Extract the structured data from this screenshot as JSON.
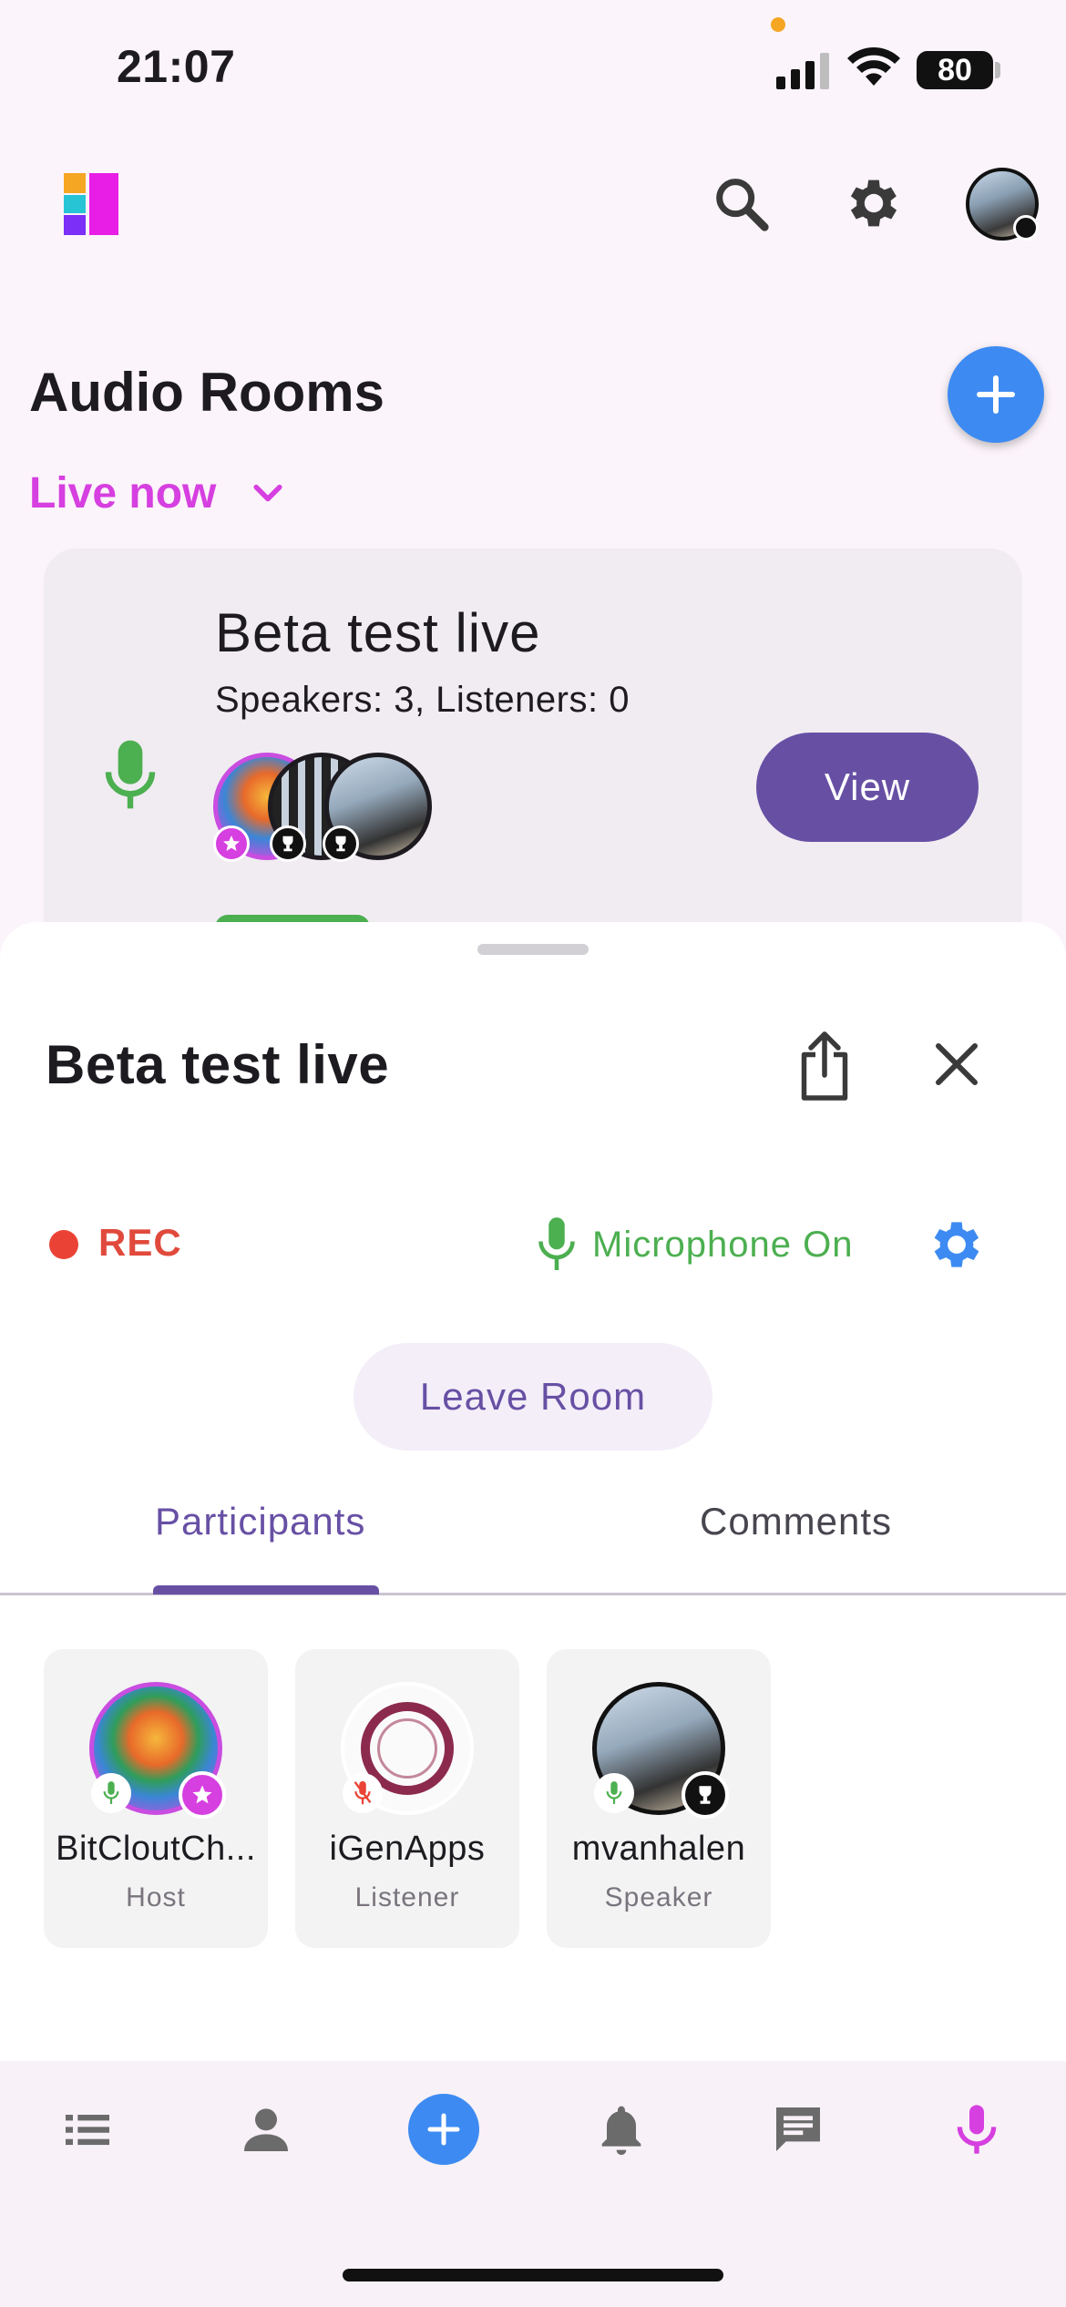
{
  "status_bar": {
    "time": "21:07",
    "battery": "80"
  },
  "header": {
    "title": "Audio Rooms",
    "filter_label": "Live now"
  },
  "room_card": {
    "title": "Beta test live",
    "subtitle": "Speakers: 3, Listeners: 0",
    "view_label": "View"
  },
  "sheet": {
    "title": "Beta test live",
    "rec_label": "REC",
    "mic_label": "Microphone On",
    "leave_label": "Leave Room",
    "tabs": [
      {
        "label": "Participants",
        "selected": true
      },
      {
        "label": "Comments",
        "selected": false
      }
    ],
    "participants": [
      {
        "name": "BitCloutCh...",
        "role": "Host",
        "mic": "on"
      },
      {
        "name": "iGenApps",
        "role": "Listener",
        "mic": "muted"
      },
      {
        "name": "mvanhalen",
        "role": "Speaker",
        "mic": "on"
      }
    ]
  },
  "colors": {
    "accent_magenta": "#d63fe0",
    "primary_purple": "#6750a4",
    "fab_blue": "#3d8bf2",
    "mic_green": "#4caf50",
    "rec_red": "#ea4335"
  },
  "bottom_nav": [
    "list-icon",
    "profile-icon",
    "add-icon",
    "bell-icon",
    "chat-icon",
    "mic-icon"
  ]
}
